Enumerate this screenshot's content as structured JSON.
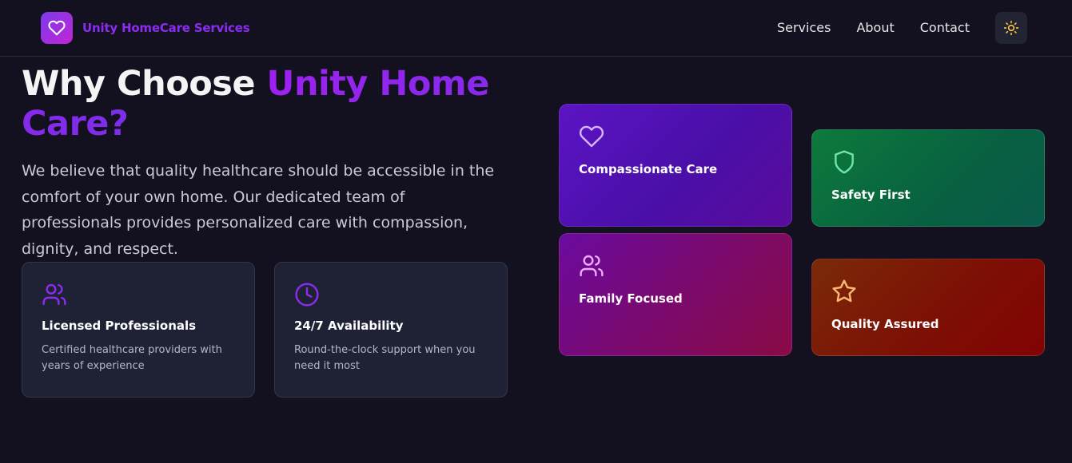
{
  "header": {
    "brand": "Unity HomeCare Services",
    "nav": [
      "Services",
      "About",
      "Contact"
    ]
  },
  "hero": {
    "title_plain": "Why Choose ",
    "title_accent": "Unity Home Care?",
    "description": "We believe that quality healthcare should be accessible in the comfort of your own home. Our dedicated team of professionals provides personalized care with compassion, dignity, and respect."
  },
  "features": [
    {
      "title": "Licensed Professionals",
      "text": "Certified healthcare providers with years of experience",
      "icon": "users-icon"
    },
    {
      "title": "24/7 Availability",
      "text": "Round-the-clock support when you need it most",
      "icon": "clock-icon"
    }
  ],
  "tiles": [
    {
      "title": "Compassionate Care",
      "icon": "heart-icon"
    },
    {
      "title": "Safety First",
      "icon": "shield-icon"
    },
    {
      "title": "Family Focused",
      "icon": "users-icon"
    },
    {
      "title": "Quality Assured",
      "icon": "star-icon"
    }
  ],
  "colors": {
    "background": "#13111f",
    "accent": "#8b2cf0",
    "card": "#1f2235"
  }
}
